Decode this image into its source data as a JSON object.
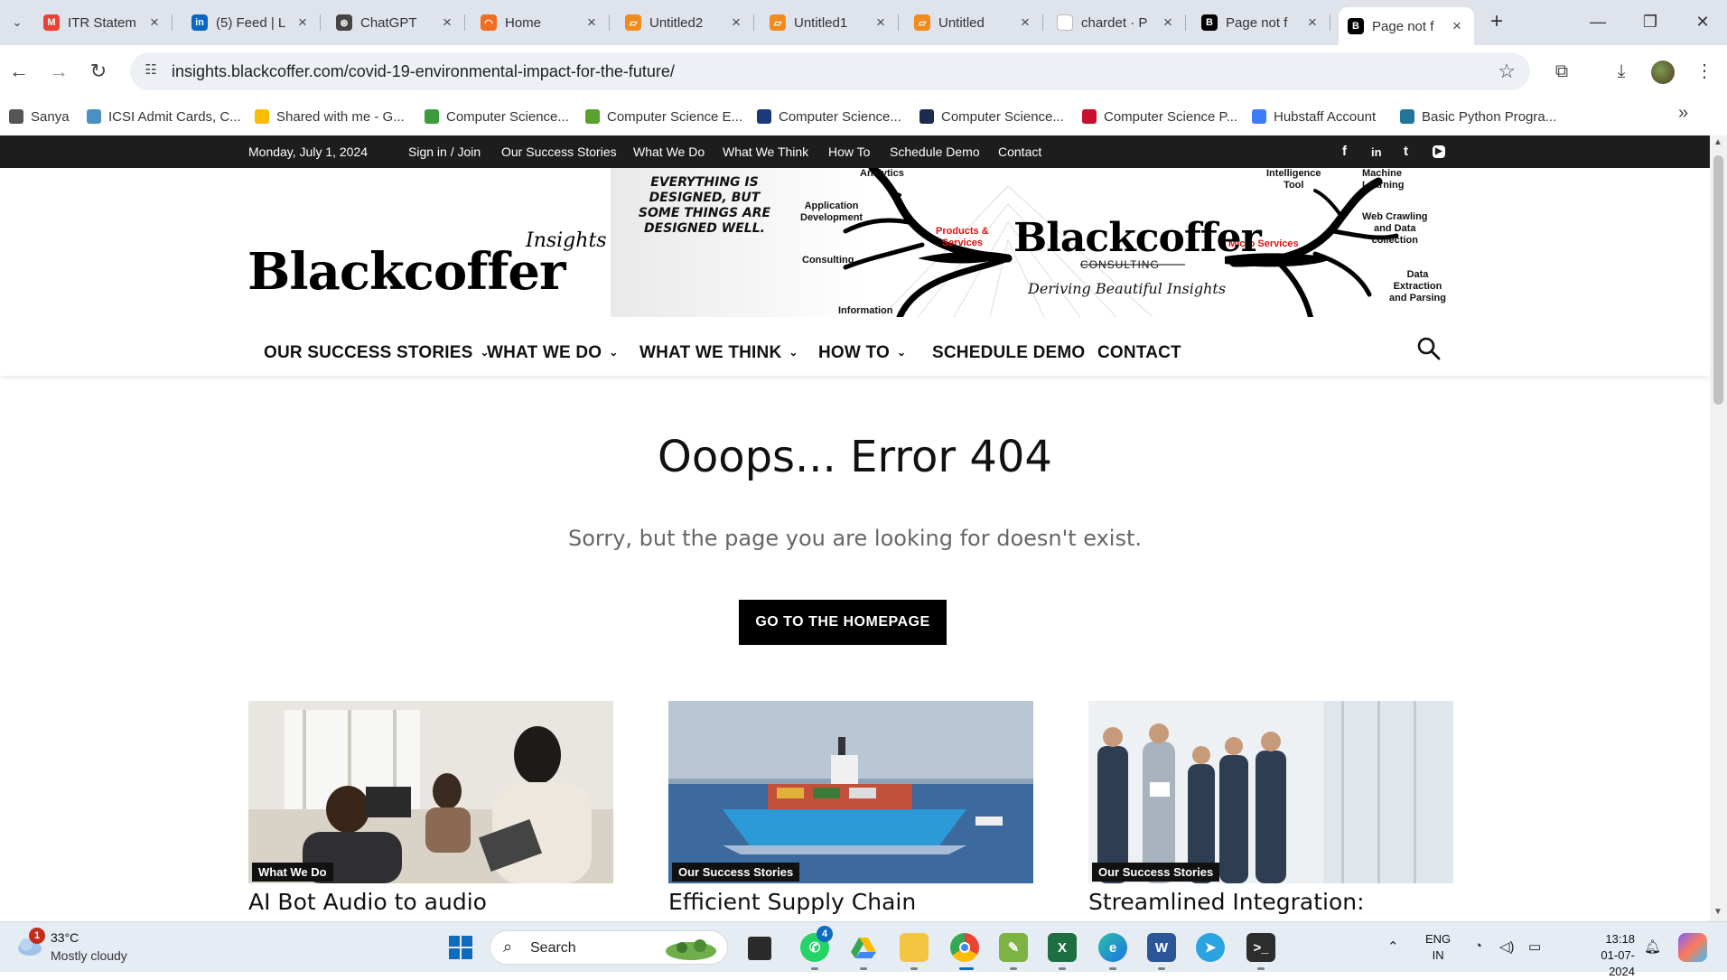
{
  "browser": {
    "tabs": [
      {
        "title": "ITR Statem",
        "icon": "gmail-icon",
        "color": "#ea4335",
        "glyph": "M"
      },
      {
        "title": "(5) Feed | L",
        "icon": "linkedin-icon",
        "color": "#0a66c2",
        "glyph": "in"
      },
      {
        "title": "ChatGPT",
        "icon": "chatgpt-icon",
        "color": "#444444",
        "glyph": "⊛"
      },
      {
        "title": "Home",
        "icon": "home-site-icon",
        "color": "#f26d21",
        "glyph": "◠"
      },
      {
        "title": "Untitled2",
        "icon": "notebook-icon",
        "color": "#f28b1e",
        "glyph": "▱"
      },
      {
        "title": "Untitled1",
        "icon": "notebook-icon",
        "color": "#f28b1e",
        "glyph": "▱"
      },
      {
        "title": "Untitled",
        "icon": "notebook-icon",
        "color": "#f28b1e",
        "glyph": "▱"
      },
      {
        "title": "chardet · P",
        "icon": "blank-page-icon",
        "color": "#ffffff",
        "glyph": ""
      },
      {
        "title": "Page not f",
        "icon": "blackcoffer-icon",
        "color": "#000000",
        "glyph": "B"
      },
      {
        "title": "Page not f",
        "icon": "blackcoffer-icon",
        "color": "#000000",
        "glyph": "B"
      }
    ],
    "url": "insights.blackcoffer.com/covid-19-environmental-impact-for-the-future/",
    "bookmarks": [
      {
        "label": "Sanya",
        "color": "#555555"
      },
      {
        "label": "ICSI Admit Cards, C...",
        "color": "#4a90c2"
      },
      {
        "label": "Shared with me - G...",
        "color": "#fbbc04"
      },
      {
        "label": "Computer Science...",
        "color": "#3c9b3c"
      },
      {
        "label": "Computer Science E...",
        "color": "#5aa02c"
      },
      {
        "label": "Computer Science...",
        "color": "#1a3a7a"
      },
      {
        "label": "Computer Science...",
        "color": "#1d2b4f"
      },
      {
        "label": "Computer Science P...",
        "color": "#c8102e"
      },
      {
        "label": "Hubstaff Account",
        "color": "#3d7bff"
      },
      {
        "label": "Basic Python Progra...",
        "color": "#21759b"
      }
    ]
  },
  "site": {
    "topbar": {
      "date": "Monday, July 1, 2024",
      "links": [
        "Sign in / Join",
        "Our Success Stories",
        "What We Do",
        "What We Think",
        "How To",
        "Schedule Demo",
        "Contact"
      ],
      "social": [
        "f",
        "in",
        "t",
        "▶"
      ]
    },
    "logo": {
      "main": "Blackcoffer",
      "sub": "Insights"
    },
    "banner": {
      "tagline": "EVERYTHING IS DESIGNED, BUT SOME THINGS ARE DESIGNED WELL.",
      "brand": "Blackcoffer",
      "consulting": "CONSULTING",
      "slogan": "Deriving Beautiful Insights",
      "labels": {
        "analytics": "Analytics",
        "app_dev": "Application\nDevelopment",
        "consulting": "Consulting",
        "information": "Information",
        "products": "Products &\nServices",
        "intelligence": "Intelligence\nTool",
        "ml": "Machine\nLearning",
        "micro": "Micro Services",
        "web": "Web Crawling\nand Data\ncollection",
        "data": "Data\nExtraction\nand Parsing"
      }
    },
    "nav": [
      {
        "label": "OUR SUCCESS STORIES",
        "dropdown": true
      },
      {
        "label": "WHAT WE DO",
        "dropdown": true
      },
      {
        "label": "WHAT WE THINK",
        "dropdown": true
      },
      {
        "label": "HOW TO",
        "dropdown": true
      },
      {
        "label": "SCHEDULE DEMO",
        "dropdown": false
      },
      {
        "label": "CONTACT",
        "dropdown": false
      }
    ],
    "error": {
      "title": "Ooops... Error 404",
      "subtitle": "Sorry, but the page you are looking for doesn't exist.",
      "button": "GO TO THE HOMEPAGE"
    },
    "cards": [
      {
        "category": "What We Do",
        "title": "AI Bot Audio to audio"
      },
      {
        "category": "Our Success Stories",
        "title": "Efficient Supply Chain"
      },
      {
        "category": "Our Success Stories",
        "title": "Streamlined Integration:"
      }
    ]
  },
  "taskbar": {
    "weather": {
      "temp": "33°C",
      "condition": "Mostly cloudy",
      "badge": "1"
    },
    "search": "Search",
    "whatsapp_badge": "4",
    "lang": {
      "line1": "ENG",
      "line2": "IN"
    },
    "time": "13:18",
    "date": "01-07-2024"
  }
}
